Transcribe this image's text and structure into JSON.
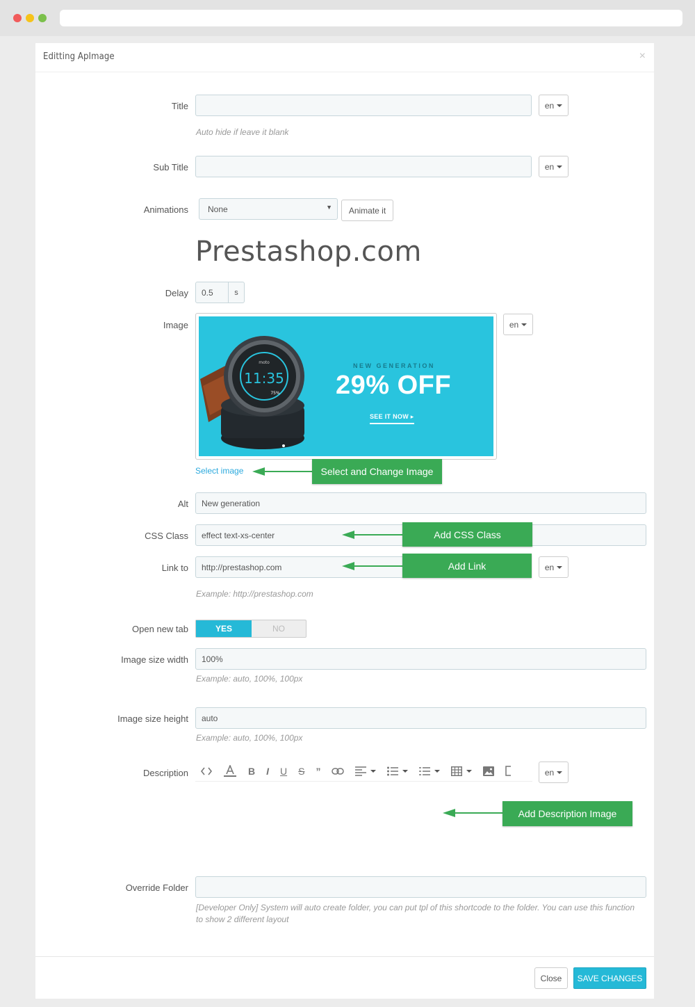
{
  "modal": {
    "title": "Editting ApImage",
    "close_x": "×"
  },
  "form": {
    "title": {
      "label": "Title",
      "value": "",
      "lang": "en",
      "help": "Auto hide if leave it blank"
    },
    "subtitle": {
      "label": "Sub Title",
      "value": "",
      "lang": "en"
    },
    "animations": {
      "label": "Animations",
      "selected": "None",
      "button": "Animate it",
      "preview_text": "Prestashop.com"
    },
    "delay": {
      "label": "Delay",
      "value": "0.5",
      "unit": "s"
    },
    "image": {
      "label": "Image",
      "lang": "en",
      "banner": {
        "subtitle": "NEW GENERATION",
        "headline": "29% OFF",
        "cta": "SEE IT NOW ▸",
        "watch_time": "11:35",
        "watch_brand": "moto",
        "watch_battery": "75%",
        "background_color": "#29c4de"
      },
      "select_link": "Select image"
    },
    "alt": {
      "label": "Alt",
      "value": "New generation"
    },
    "css_class": {
      "label": "CSS Class",
      "value": "effect text-xs-center"
    },
    "link_to": {
      "label": "Link to",
      "value": "http://prestashop.com",
      "lang": "en",
      "help": "Example: http://prestashop.com"
    },
    "open_new_tab": {
      "label": "Open new tab",
      "yes": "YES",
      "no": "NO",
      "selected": "YES"
    },
    "image_width": {
      "label": "Image size width",
      "value": "100%",
      "help": "Example: auto, 100%, 100px"
    },
    "image_height": {
      "label": "Image size height",
      "value": "auto",
      "help": "Example: auto, 100%, 100px"
    },
    "description": {
      "label": "Description",
      "lang": "en",
      "toolbar": [
        "code-icon",
        "font-color-icon",
        "bold-icon",
        "italic-icon",
        "underline-icon",
        "strikethrough-icon",
        "quote-icon",
        "link-icon",
        "align-icon",
        "bullet-list-icon",
        "numbered-list-icon",
        "table-icon",
        "image-icon",
        "copy-icon"
      ]
    },
    "override_folder": {
      "label": "Override Folder",
      "value": "",
      "help": "[Developer Only] System will auto create folder, you can put tpl of this shortcode to the folder. You can use this function to show 2 different layout"
    }
  },
  "callouts": {
    "select_image": "Select and Change Image",
    "css_class": "Add CSS Class",
    "link": "Add Link",
    "description_image": "Add Description Image"
  },
  "footer": {
    "close": "Close",
    "save": "SAVE CHANGES"
  },
  "colors": {
    "accent": "#25b9d7",
    "callout": "#3aaa55",
    "link": "#2ba9dd"
  }
}
